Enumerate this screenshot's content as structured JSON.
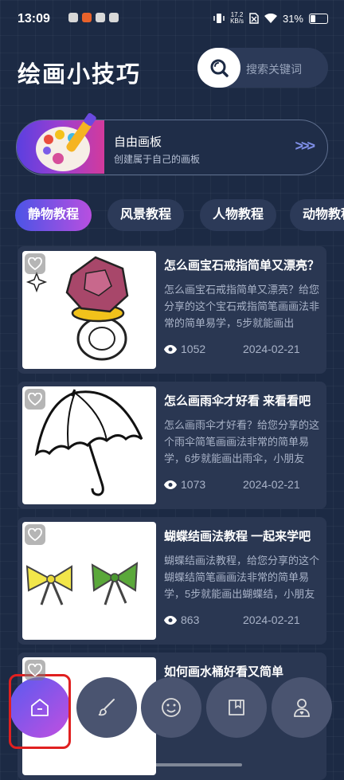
{
  "status_bar": {
    "time": "13:09",
    "speed_top": "17.2",
    "speed_bottom": "KB/s",
    "battery": "31%"
  },
  "header": {
    "title": "绘画小技巧",
    "search_placeholder": "搜索关键词"
  },
  "banner": {
    "title": "自由画板",
    "subtitle": "创建属于自己的画板",
    "arrows": ">>>"
  },
  "tabs": [
    {
      "label": "静物教程",
      "active": true
    },
    {
      "label": "风景教程",
      "active": false
    },
    {
      "label": "人物教程",
      "active": false
    },
    {
      "label": "动物教程",
      "active": false
    }
  ],
  "cards": [
    {
      "title": "怎么画宝石戒指简单又漂亮？",
      "desc": "怎么画宝石戒指简单又漂亮？给您分享的这个宝石戒指简笔画画法非常的简单易学，5步就能画出",
      "views": "1052",
      "date": "2024-02-21",
      "image": "gem-ring-drawing"
    },
    {
      "title": "怎么画雨伞才好看 来看看吧",
      "desc": "怎么画雨伞才好看？给您分享的这个雨伞简笔画画法非常的简单易学，6步就能画出雨伞，小朋友",
      "views": "1073",
      "date": "2024-02-21",
      "image": "umbrella-drawing"
    },
    {
      "title": "蝴蝶结画法教程 一起来学吧",
      "desc": "蝴蝶结画法教程，给您分享的这个蝴蝶结简笔画画法非常的简单易学，5步就能画出蝴蝶结，小朋友",
      "views": "863",
      "date": "2024-02-21",
      "image": "bow-drawing"
    },
    {
      "title": "如何画水桶好看又简单",
      "desc": "",
      "views": "",
      "date": "",
      "image": "bucket-drawing"
    }
  ],
  "bottom_nav": [
    {
      "name": "home",
      "icon": "home-icon",
      "active": true
    },
    {
      "name": "brush",
      "icon": "brush-icon",
      "active": false
    },
    {
      "name": "face",
      "icon": "smiley-icon",
      "active": false
    },
    {
      "name": "collection",
      "icon": "bookmark-book-icon",
      "active": false
    },
    {
      "name": "profile",
      "icon": "user-icon",
      "active": false
    }
  ],
  "colors": {
    "background": "#1c2a44",
    "card": "#2a3752",
    "accent_start": "#4b54e6",
    "accent_end": "#b84fe0",
    "highlight": "#e02020"
  }
}
